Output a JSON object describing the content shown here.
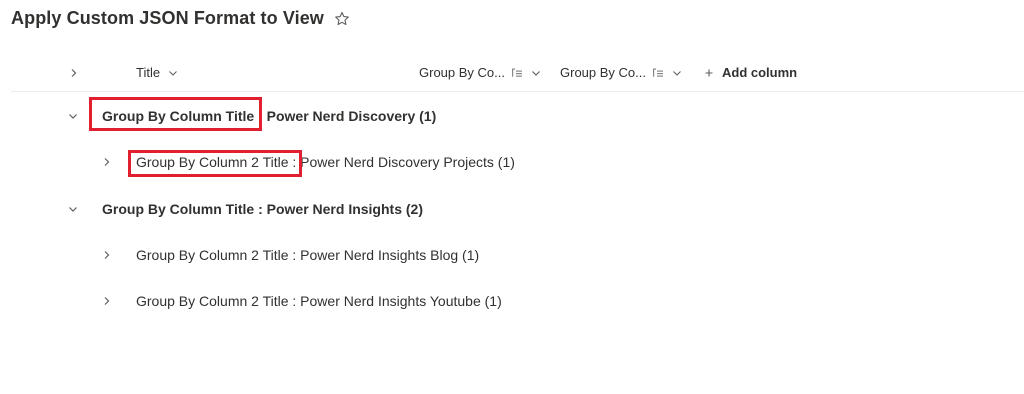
{
  "page": {
    "title": "Apply Custom JSON Format to View",
    "favorite_icon": "star-icon"
  },
  "header": {
    "expand_icon": "chevron-right-icon",
    "columns": [
      {
        "label": "Title",
        "icon": "chevron-down-icon"
      },
      {
        "label": "Group By Co...",
        "icons": [
          "grouped-column-icon",
          "chevron-down-icon"
        ]
      },
      {
        "label": "Group By Co...",
        "icons": [
          "grouped-column-icon",
          "chevron-down-icon"
        ]
      }
    ],
    "add_column_label": "Add column",
    "add_column_icon": "plus-icon"
  },
  "groups": [
    {
      "label": "Group By Column Title : Power Nerd Discovery (1)",
      "expanded": true,
      "highlighted_text": "Group By Column Title",
      "children": [
        {
          "label": "Group By Column 2 Title : Power Nerd Discovery Projects (1)",
          "expanded": false,
          "highlighted_text": "Group By Column 2 Title"
        }
      ]
    },
    {
      "label": "Group By Column Title : Power Nerd Insights (2)",
      "expanded": true,
      "children": [
        {
          "label": "Group By Column 2 Title : Power Nerd Insights Blog (1)",
          "expanded": false
        },
        {
          "label": "Group By Column 2 Title : Power Nerd Insights Youtube (1)",
          "expanded": false
        }
      ]
    }
  ],
  "colors": {
    "highlight_border": "#e0202e",
    "text": "#323130",
    "icon": "#605e5c",
    "divider": "#edebe9"
  }
}
